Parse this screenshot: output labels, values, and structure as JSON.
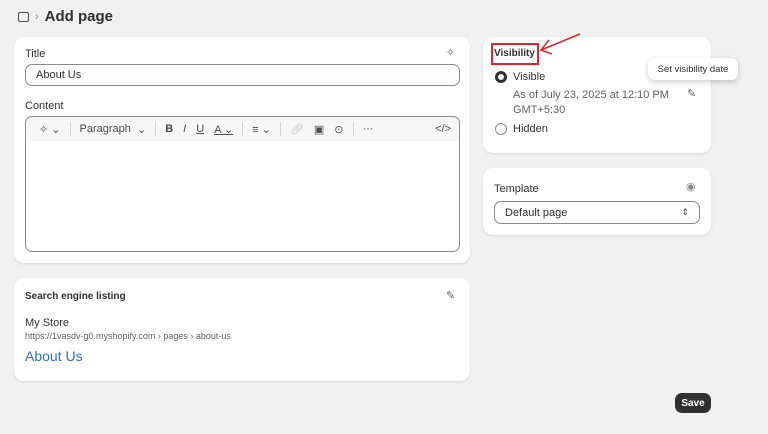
{
  "header": {
    "title": "Add page",
    "icon": "pages-icon"
  },
  "main": {
    "title_label": "Title",
    "title_value": "About Us",
    "content_label": "Content",
    "toolbar": {
      "format_select": "Paragraph"
    }
  },
  "seo": {
    "heading": "Search engine listing",
    "store": "My Store",
    "url": "https://1vasdv-g0.myshopify.com › pages › about-us",
    "page_title": "About Us"
  },
  "visibility": {
    "heading": "Visibility",
    "options": [
      {
        "label": "Visible",
        "selected": true
      },
      {
        "label": "Hidden",
        "selected": false
      }
    ],
    "date_line1": "As of July 23, 2025 at 12:10 PM",
    "date_line2": "GMT+5:30",
    "tooltip": "Set visibility date"
  },
  "template": {
    "label": "Template",
    "value": "Default page"
  },
  "save_label": "Save",
  "colors": {
    "annotation": "#e0242b",
    "link": "#2c6ecb",
    "button": "#303030"
  }
}
